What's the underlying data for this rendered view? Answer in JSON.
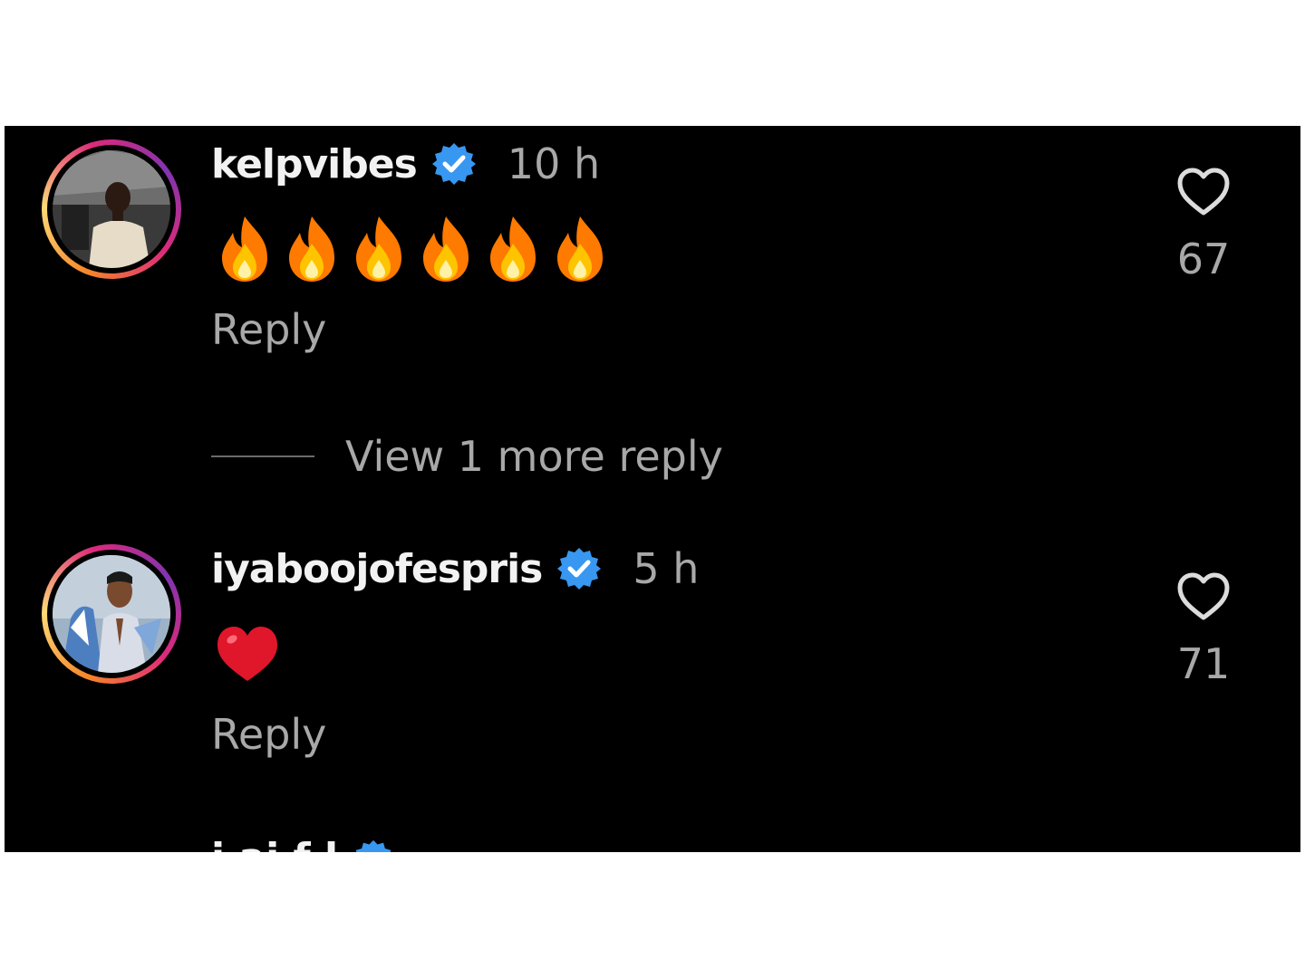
{
  "comments": [
    {
      "username": "kelpvibes",
      "verified": true,
      "time": "10 h",
      "body_emojis": [
        "fire",
        "fire",
        "fire",
        "fire",
        "fire",
        "fire"
      ],
      "reply_label": "Reply",
      "like_count": "67",
      "liked": false
    },
    {
      "username": "iyaboojofespris",
      "verified": true,
      "time": "5 h",
      "body_emojis": [
        "red-heart"
      ],
      "reply_label": "Reply",
      "like_count": "71",
      "liked": false
    }
  ],
  "view_more": {
    "label": "View 1 more reply"
  },
  "cutoff_comment": {
    "partial_username": "i  ai f  l"
  },
  "colors": {
    "background": "#000000",
    "primary_text": "#f2f2f2",
    "secondary_text": "#a8a8a8",
    "verified_badge": "#3897f0",
    "fire": "#ff7a00",
    "heart": "#e0162b"
  },
  "icons": {
    "verified": "verified-badge-icon",
    "like": "heart-outline-icon"
  }
}
